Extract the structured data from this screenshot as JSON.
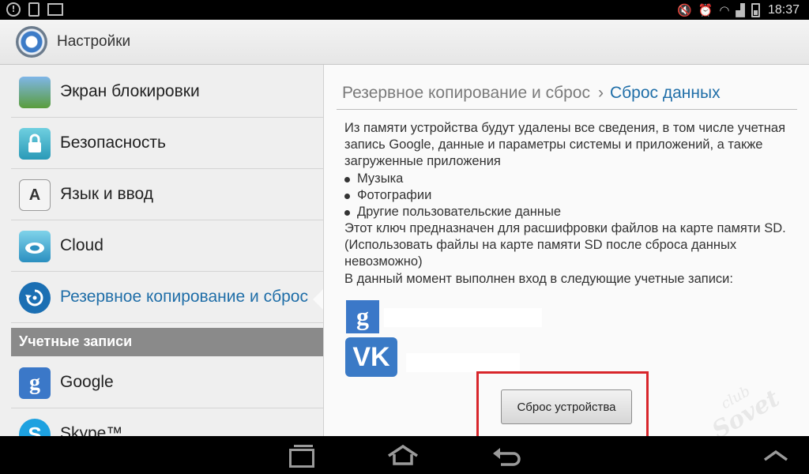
{
  "status_bar": {
    "left_icons": [
      "alert-icon",
      "sim-icon",
      "gallery-icon"
    ],
    "right_icons": [
      "mute-icon",
      "alarm-icon",
      "wifi-icon",
      "signal-icon",
      "battery-icon"
    ],
    "time": "18:37"
  },
  "action_bar": {
    "title": "Настройки",
    "icon": "settings-icon"
  },
  "menu": {
    "items": [
      {
        "label": "Экран блокировки",
        "icon": "lock-screen-icon"
      },
      {
        "label": "Безопасность",
        "icon": "padlock-icon"
      },
      {
        "label": "Язык и ввод",
        "icon": "keyboard-a-icon"
      },
      {
        "label": "Cloud",
        "icon": "cloud-icon"
      },
      {
        "label": "Резервное копирование и сброс",
        "icon": "backup-restore-icon",
        "active": true
      }
    ],
    "section_header": "Учетные записи",
    "accounts": [
      {
        "label": "Google",
        "icon": "google-icon"
      },
      {
        "label": "Skype™",
        "icon": "skype-icon"
      }
    ]
  },
  "detail": {
    "breadcrumb_parent": "Резервное копирование и сброс",
    "breadcrumb_separator": "›",
    "breadcrumb_current": "Сброс данных",
    "intro": "Из памяти устройства будут удалены все сведения, в том числе учетная запись Google, данные и параметры системы и приложений, а также загруженные приложения",
    "bullets": [
      "Музыка",
      "Фотографии",
      "Другие пользовательские данные"
    ],
    "sd_note": "Этот ключ предназначен для расшифровки файлов на карте памяти SD. (Использовать файлы на карте памяти SD после сброса данных невозможно)",
    "accounts_note": "В данный момент выполнен вход в следующие учетные записи:",
    "account_icons": [
      "google-account-icon",
      "vk-account-icon"
    ],
    "reset_button": "Сброс устройства"
  },
  "watermark": {
    "line1": "club",
    "line2": "Sovet"
  },
  "nav_bar": {
    "buttons": [
      "recent-apps-icon",
      "home-icon",
      "back-icon",
      "up-arrow-icon"
    ]
  },
  "colors": {
    "accent": "#1f6ea8",
    "highlight_frame": "#d8262b",
    "section_header_bg": "#8a8a8a"
  }
}
